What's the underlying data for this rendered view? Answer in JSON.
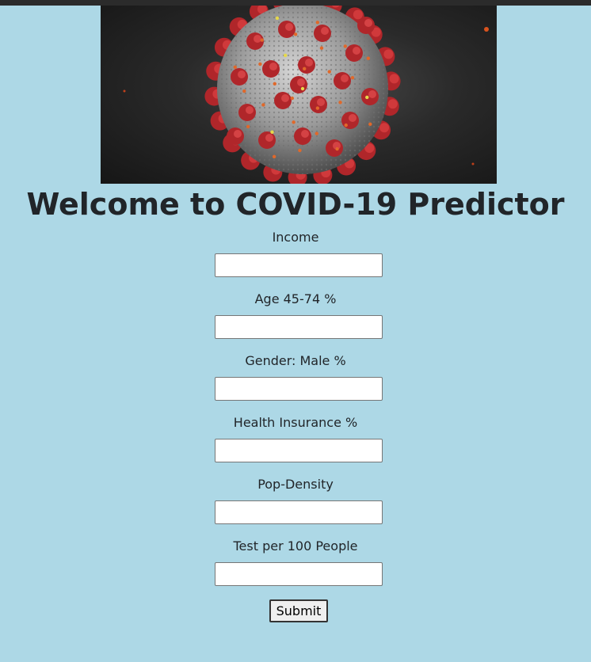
{
  "hero": {
    "image_name": "coronavirus-illustration"
  },
  "page": {
    "title": "Welcome to COVID-19 Predictor"
  },
  "form": {
    "fields": [
      {
        "label": "Income",
        "value": ""
      },
      {
        "label": "Age 45-74 %",
        "value": ""
      },
      {
        "label": "Gender: Male %",
        "value": ""
      },
      {
        "label": "Health Insurance %",
        "value": ""
      },
      {
        "label": "Pop-Density",
        "value": ""
      },
      {
        "label": "Test per 100 People",
        "value": ""
      }
    ],
    "submit_label": "Submit"
  },
  "colors": {
    "background": "#add8e6",
    "text": "#212529",
    "virus_red": "#b0262a",
    "virus_body": "#a8a8a8"
  }
}
